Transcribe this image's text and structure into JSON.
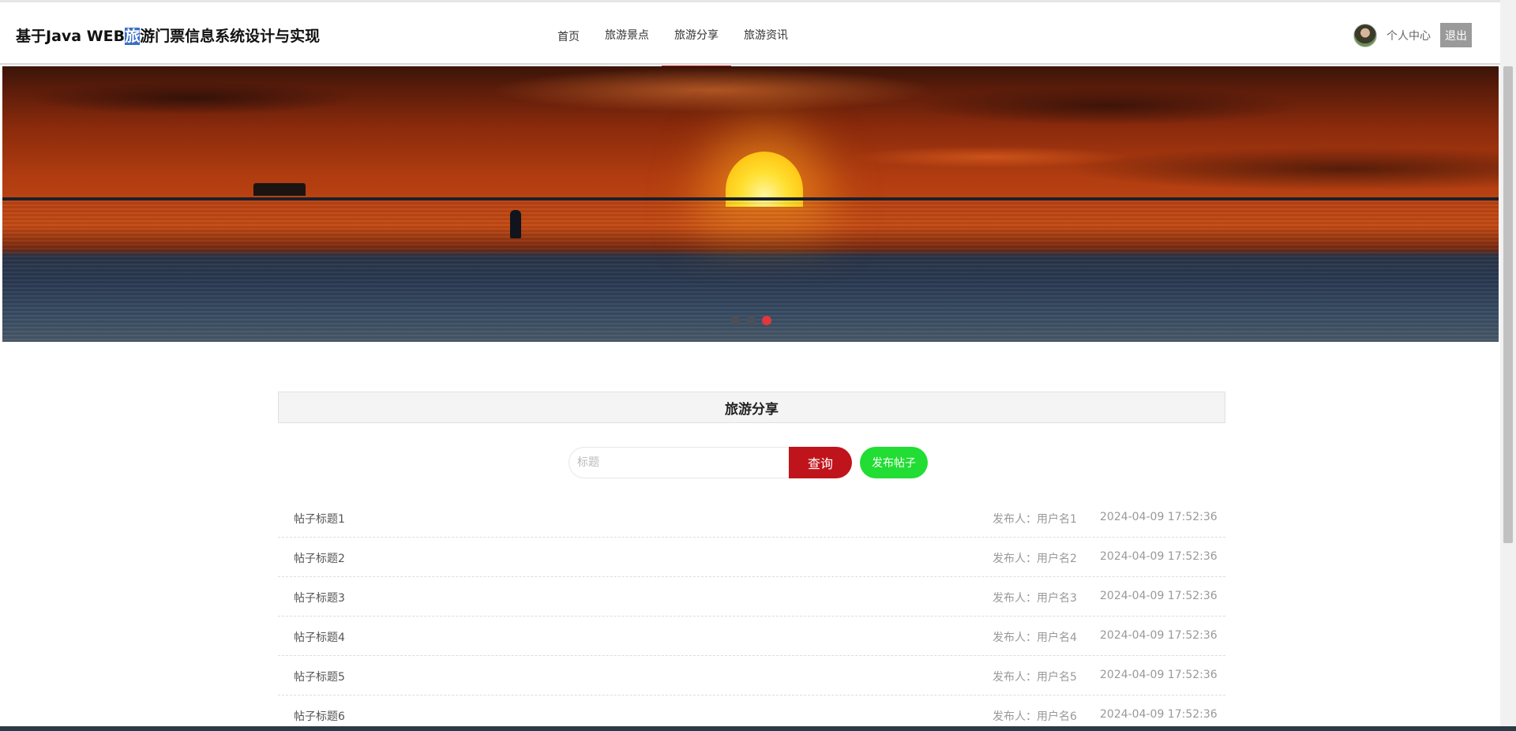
{
  "header": {
    "title_before": "基于Java WEB",
    "title_highlight": "旅",
    "title_after": "游门票信息系统设计与实现",
    "nav": [
      {
        "label": "首页"
      },
      {
        "label": "旅游景点"
      },
      {
        "label": "旅游分享",
        "active": true
      },
      {
        "label": "旅游资讯"
      }
    ],
    "user_center_label": "个人中心",
    "logout_label": "退出"
  },
  "banner": {
    "icon": "sunset-sea-photo",
    "dots_total": 3,
    "active_dot": 3
  },
  "section": {
    "title": "旅游分享",
    "search_placeholder": "标题",
    "search_value": "",
    "search_button": "查询",
    "publish_button": "发布帖子"
  },
  "posts": [
    {
      "title": "帖子标题1",
      "author": "发布人：用户名1",
      "time": "2024-04-09 17:52:36"
    },
    {
      "title": "帖子标题2",
      "author": "发布人：用户名2",
      "time": "2024-04-09 17:52:36"
    },
    {
      "title": "帖子标题3",
      "author": "发布人：用户名3",
      "time": "2024-04-09 17:52:36"
    },
    {
      "title": "帖子标题4",
      "author": "发布人：用户名4",
      "time": "2024-04-09 17:52:36"
    },
    {
      "title": "帖子标题5",
      "author": "发布人：用户名5",
      "time": "2024-04-09 17:52:36"
    },
    {
      "title": "帖子标题6",
      "author": "发布人：用户名6",
      "time": "2024-04-09 17:52:36"
    }
  ],
  "colors": {
    "accent": "#c0141c",
    "publish": "#22dd33",
    "active_dot": "#e0383e"
  }
}
